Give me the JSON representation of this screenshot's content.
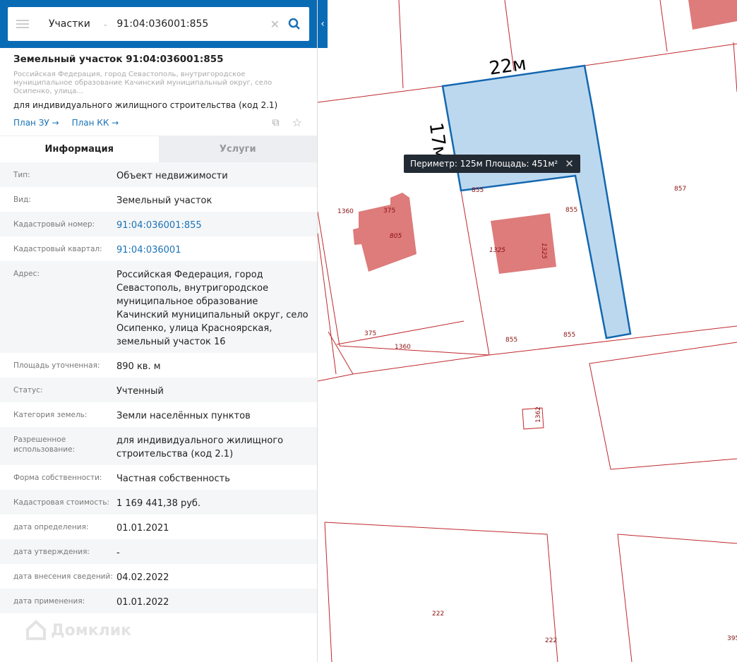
{
  "search": {
    "category": "Участки",
    "query": "91:04:036001:855"
  },
  "object": {
    "title": "Земельный участок 91:04:036001:855",
    "address_short": "Российская Федерация, город Севастополь, внутригородское муниципальное образование Качинский муниципальный округ, село Осипенко, улица...",
    "purpose": "для индивидуального жилищного строительства (код 2.1)",
    "link_plan_zu": "План ЗУ →",
    "link_plan_kk": "План КК →"
  },
  "tabs": [
    {
      "label": "Информация"
    },
    {
      "label": "Услуги"
    }
  ],
  "rows": [
    {
      "k": "Тип:",
      "v": "Объект недвижимости"
    },
    {
      "k": "Вид:",
      "v": "Земельный участок"
    },
    {
      "k": "Кадастровый номер:",
      "v": "91:04:036001:855"
    },
    {
      "k": "Кадастровый квартал:",
      "v": "91:04:036001"
    },
    {
      "k": "Адрес:",
      "v": "Российская Федерация, город Севастополь, внутригородское муниципальное образование Качинский муниципальный округ, село Осипенко, улица Красноярская, земельный участок 16"
    },
    {
      "k": "Площадь уточненная:",
      "v": "890 кв. м"
    },
    {
      "k": "Статус:",
      "v": "Учтенный"
    },
    {
      "k": "Категория земель:",
      "v": "Земли населённых пунктов"
    },
    {
      "k": "Разрешенное использование:",
      "v": "для индивидуального жилищного строительства (код 2.1)"
    },
    {
      "k": "Форма собственности:",
      "v": "Частная собственность"
    },
    {
      "k": "Кадастровая стоимость:",
      "v": "1 169 441,38 руб."
    },
    {
      "k": "дата определения:",
      "v": "01.01.2021"
    },
    {
      "k": "дата утверждения:",
      "v": "-"
    },
    {
      "k": "дата внесения сведений:",
      "v": "04.02.2022"
    },
    {
      "k": "дата применения:",
      "v": "01.01.2022"
    }
  ],
  "logo": "Домклик",
  "map": {
    "measure_top": "22м",
    "measure_side": "17м",
    "tooltip": "Периметр: 125м Площадь: 451м²",
    "labels": [
      "855",
      "855",
      "857",
      "1360",
      "375",
      "805",
      "1325",
      "1325",
      "375",
      "1360",
      "855",
      "855",
      "1362",
      "222",
      "222",
      "395"
    ]
  },
  "colors": {
    "accent": "#0a6bb5",
    "parcel_fill": "#bcd8ee",
    "boundary": "#c0282d",
    "building": "#de7b7b"
  }
}
